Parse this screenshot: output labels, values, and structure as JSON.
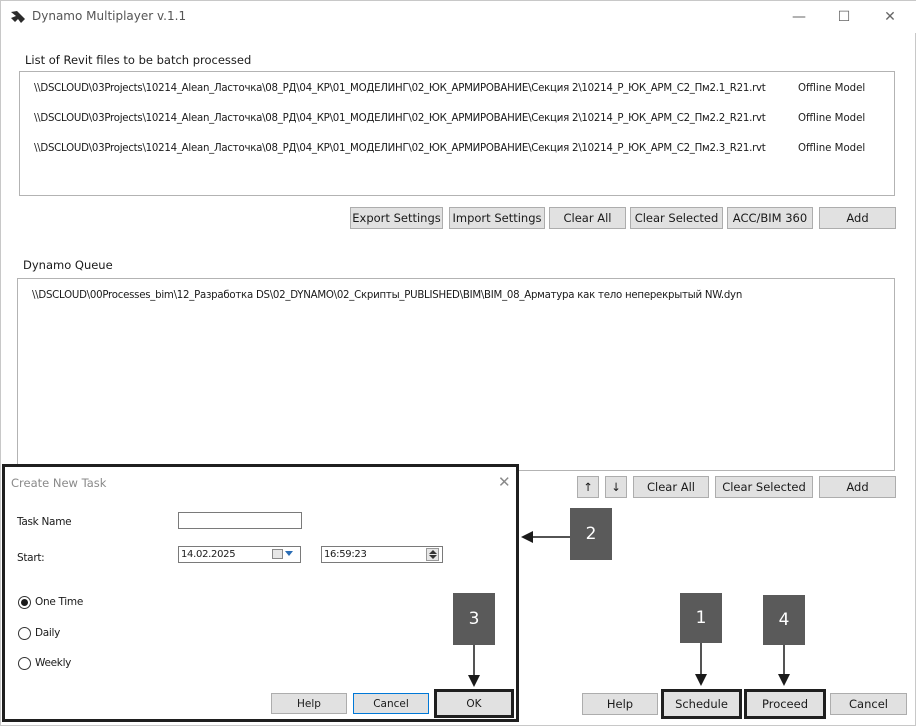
{
  "window": {
    "title": "Dynamo Multiplayer v.1.1",
    "minimize": "—",
    "maximize": "☐",
    "close": "✕"
  },
  "files_section": {
    "label": "List of Revit files to be batch processed",
    "files": [
      {
        "path": "\\\\DSCLOUD\\03Projects\\10214_Alean_Ласточка\\08_РД\\04_КР\\01_МОДЕЛИНГ\\02_ЮК_АРМИРОВАНИЕ\\Секция 2\\10214_Р_ЮК_АРМ_С2_Пм2.1_R21.rvt",
        "status": "Offline Model"
      },
      {
        "path": "\\\\DSCLOUD\\03Projects\\10214_Alean_Ласточка\\08_РД\\04_КР\\01_МОДЕЛИНГ\\02_ЮК_АРМИРОВАНИЕ\\Секция 2\\10214_Р_ЮК_АРМ_С2_Пм2.2_R21.rvt",
        "status": "Offline Model"
      },
      {
        "path": "\\\\DSCLOUD\\03Projects\\10214_Alean_Ласточка\\08_РД\\04_КР\\01_МОДЕЛИНГ\\02_ЮК_АРМИРОВАНИЕ\\Секция 2\\10214_Р_ЮК_АРМ_С2_Пм2.3_R21.rvt",
        "status": "Offline Model"
      }
    ],
    "buttons": {
      "export": "Export Settings",
      "import": "Import Settings",
      "clear_all": "Clear All",
      "clear_selected": "Clear Selected",
      "acc": "ACC/BIM 360",
      "add": "Add"
    }
  },
  "queue_section": {
    "label": "Dynamo Queue",
    "items": [
      "\\\\DSCLOUD\\00Processes_bim\\12_Разработка DS\\02_DYNAMO\\02_Скрипты_PUBLISHED\\BIM\\BIM_08_Арматура как тело неперекрытый NW.dyn"
    ],
    "buttons": {
      "up": "↑",
      "down": "↓",
      "clear_all": "Clear All",
      "clear_selected": "Clear Selected",
      "add": "Add"
    }
  },
  "footer": {
    "help": "Help",
    "schedule": "Schedule",
    "proceed": "Proceed",
    "cancel": "Cancel"
  },
  "dialog": {
    "title": "Create New Task",
    "close": "✕",
    "task_name_label": "Task Name",
    "task_name_value": "",
    "start_label": "Start:",
    "date_value": "14.02.2025",
    "time_value": "16:59:23",
    "options": [
      "One Time",
      "Daily",
      "Weekly"
    ],
    "selected_option": "One Time",
    "buttons": {
      "help": "Help",
      "cancel": "Cancel",
      "ok": "OK"
    }
  },
  "callouts": [
    "1",
    "2",
    "3",
    "4"
  ]
}
